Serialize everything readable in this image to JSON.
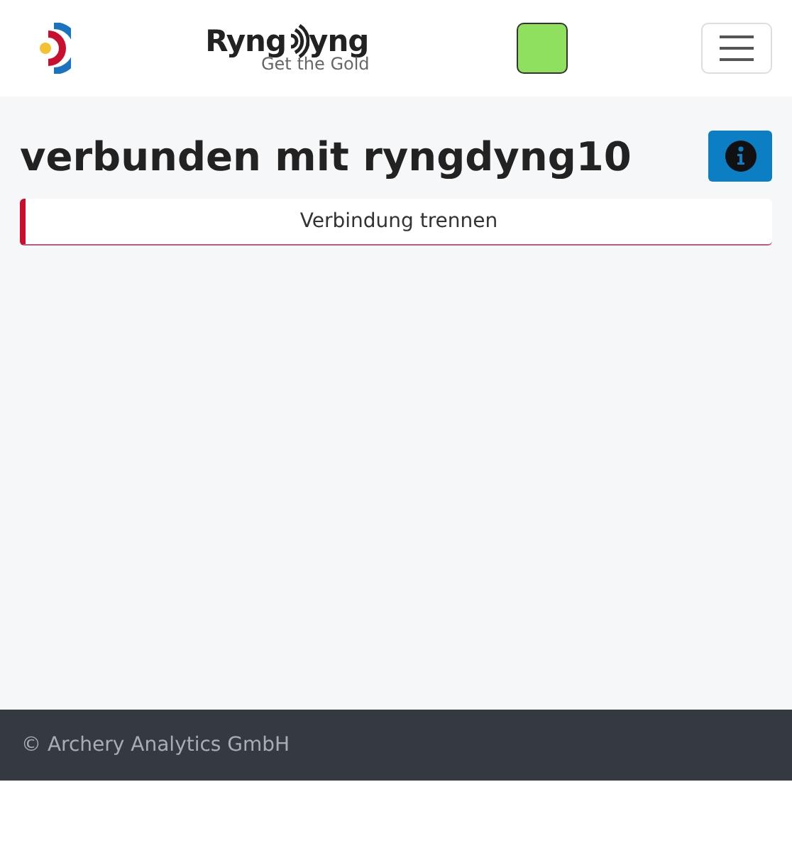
{
  "header": {
    "logo": {
      "left": "Ryng",
      "right": "yng",
      "tagline": "Get the Gold"
    },
    "status_indicator": {
      "color": "#8fe05e"
    }
  },
  "title": "verbunden mit ryngdyng10",
  "disconnect_button": "Verbindung trennen",
  "footer": "© Archery Analytics GmbH"
}
